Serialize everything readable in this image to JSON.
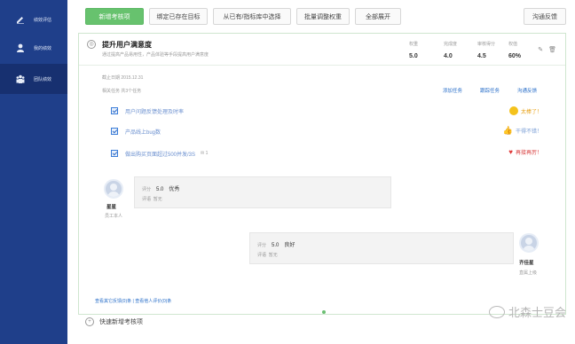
{
  "sidebar": {
    "items": [
      {
        "label": "绩效评估",
        "icon": "pencil-icon"
      },
      {
        "label": "我的绩效",
        "icon": "user-icon"
      },
      {
        "label": "团队绩效",
        "icon": "team-icon"
      }
    ],
    "active_index": 2
  },
  "toolbar": {
    "buttons": [
      "新增考核项",
      "绑定已存在目标",
      "从已有/指标库中选择",
      "批量调整权重",
      "全部展开"
    ],
    "right_button": "沟通反馈"
  },
  "card": {
    "title": "提升用户满意度",
    "subtitle": "通过提高产品易用性，产品体验等手段提高用户满意度",
    "stats": [
      {
        "label": "权重",
        "value": "5.0"
      },
      {
        "label": "完成度",
        "value": "4.0"
      },
      {
        "label": "审核得分",
        "value": "4.5"
      },
      {
        "label": "权值",
        "value": "60%"
      }
    ],
    "deadline": "截止日期  2015.12.31",
    "related": "相关任务  共3个任务",
    "links": [
      "添加任务",
      "跟踪任务",
      "沟通反馈"
    ],
    "tasks": [
      {
        "text": "用户问题反馈处理及时率",
        "status": "太棒了！",
        "status_icon": "smile-icon"
      },
      {
        "text": "产品线上bug数",
        "status": "干得不错！",
        "status_icon": "thumbs-up-icon"
      },
      {
        "text": "做出购买页面超过500并发/3S",
        "extra": "1",
        "status": "再接再厉！",
        "status_icon": "heart-icon"
      }
    ],
    "comments": [
      {
        "name": "星星",
        "role": "员工本人",
        "score_label": "评分",
        "score": "5.0",
        "grade": "优秀",
        "remark_label": "评语",
        "remark": "暂无"
      },
      {
        "name": "齐佳星",
        "role": "直属上级",
        "score_label": "评分",
        "score": "5.0",
        "grade": "良好",
        "remark_label": "评语",
        "remark": "暂无"
      }
    ],
    "footer": "查看其它反馈(0)条 | 查看他人评价(0)条"
  },
  "quick_add": "快速新增考核项",
  "watermark": "北森士豆会"
}
